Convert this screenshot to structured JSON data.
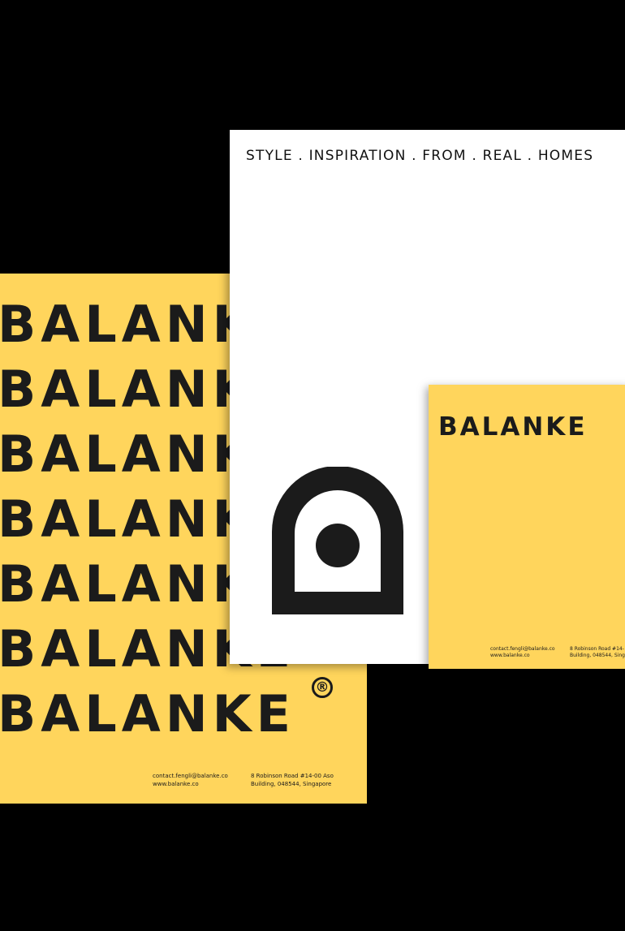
{
  "colors": {
    "background": "#000000",
    "yellow": "#ffd55c",
    "ink": "#1b1b1b",
    "paper": "#ffffff"
  },
  "yellow_sheet": {
    "repeat_words": [
      "BALANKE",
      "BALANKE",
      "BALANKE",
      "BALANKE",
      "BALANKE",
      "BALANKE",
      "BALANKE"
    ],
    "registered_mark": "®",
    "contact_email": "contact.fengli@balanke.co",
    "contact_web": "www.balanke.co",
    "address_line1": "8 Robinson Road #14-00 Aso",
    "address_line2": "Building, 048544, Singapore"
  },
  "white_sheet": {
    "tagline": "STYLE . INSPIRATION . FROM . REAL . HOMES",
    "logo_icon": "arch-with-dot-icon"
  },
  "yellow_card": {
    "word": "BALANKE",
    "contact_email": "contact.fengli@balanke.co",
    "contact_web": "www.balanke.co",
    "address_line1": "8 Robinson Road #14-",
    "address_line2": "Building, 048544, Singa"
  }
}
